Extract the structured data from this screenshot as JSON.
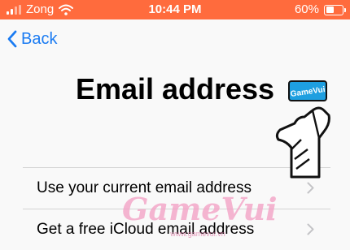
{
  "status_bar": {
    "carrier": "Zong",
    "time": "10:44 PM",
    "battery_percent": "60%",
    "battery_level": 0.6,
    "background_color": "#ff6b3d"
  },
  "nav": {
    "back_label": "Back",
    "accent_color": "#1a7bf2"
  },
  "page": {
    "title": "Email address"
  },
  "options": [
    {
      "label": "Use your current email address",
      "icon": "chevron-right-icon"
    },
    {
      "label": "Get a free iCloud email address",
      "icon": "chevron-right-icon"
    }
  ],
  "overlay": {
    "badge_text": "GameVui",
    "watermark_text": "GameVui",
    "watermark_subtext": "www.gamevui.vn"
  }
}
